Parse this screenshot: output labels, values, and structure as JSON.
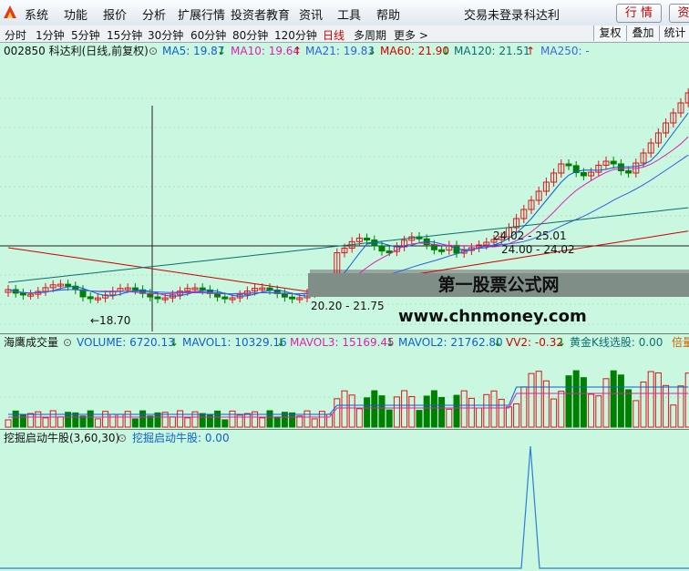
{
  "menu": {
    "items": [
      "系统",
      "功能",
      "报价",
      "分析",
      "扩展行情",
      "投资者教育",
      "资讯",
      "工具",
      "帮助"
    ],
    "status_left": "交易未登录",
    "status_right": "科达利",
    "quote_btn": "行 情",
    "trade_btn": "资"
  },
  "periods": {
    "items": [
      "分时",
      "1分钟",
      "5分钟",
      "15分钟",
      "30分钟",
      "60分钟",
      "80分钟",
      "120分钟",
      "日线",
      "多周期",
      "更多 >"
    ],
    "active": "日线",
    "right_buttons": [
      "复权",
      "叠加",
      "统计"
    ]
  },
  "main_info": {
    "stock": "002850 科达利(日线,前复权)",
    "ma5": "MA5: 19.87",
    "ma10": "MA10: 19.64",
    "ma21": "MA21: 19.83",
    "ma60": "MA60: 21.90",
    "ma120": "MA120: 21.51",
    "ma250": "MA250: -",
    "arrow_down": "↓",
    "arrow_up": "↑"
  },
  "price_labels": {
    "low": "←18.70",
    "band1": "24.02 - 25.01",
    "band2": "24.00 - 24.02",
    "band3": "20.20 - 21.75"
  },
  "overlay": {
    "watermark": "第一股票公式网",
    "site": "www.chnmoney.com"
  },
  "volume_info": {
    "name": "海鹰成交量",
    "volume": "VOLUME: 6720.13",
    "mavol1": "MAVOL1: 10329.16",
    "mavol3": "MAVOL3: 15169.45",
    "mavol2": "MAVOL2: 21762.80",
    "vv2": "VV2: -0.32",
    "gold": "黄金K线选股: 0.00",
    "tail": "倍量"
  },
  "ind_info": {
    "name": "挖掘启动牛股(3,60,30)",
    "value": "挖掘启动牛股: 0.00"
  },
  "colors": {
    "up": "#e0141a",
    "down": "#008000",
    "ma5": "#0f5fd2",
    "ma10": "#e020b0",
    "ma21": "#3060e0",
    "ma60": "#d00000",
    "ma120": "#0a7070",
    "ma250": "#3a6ad8",
    "background": "#c9f7df"
  }
}
